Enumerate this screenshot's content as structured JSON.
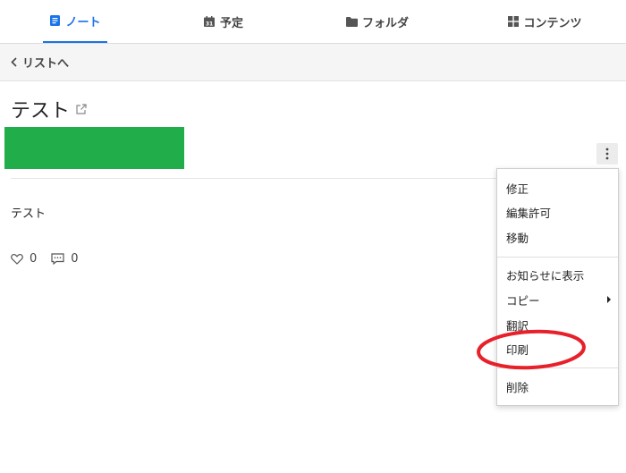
{
  "tabs": [
    {
      "label": "ノート",
      "icon": "note-icon",
      "active": true
    },
    {
      "label": "予定",
      "icon": "calendar-icon",
      "active": false
    },
    {
      "label": "フォルダ",
      "icon": "folder-icon",
      "active": false
    },
    {
      "label": "コンテンツ",
      "icon": "grid-icon",
      "active": false
    }
  ],
  "back": {
    "label": "リストへ",
    "icon": "chevron-left-icon"
  },
  "note": {
    "title": "テスト",
    "body": "テスト",
    "likes": "0",
    "comments": "0"
  },
  "menu": {
    "edit": "修正",
    "edit_permission": "編集許可",
    "move": "移動",
    "show_in_notice": "お知らせに表示",
    "copy": "コピー",
    "translate": "翻訳",
    "print": "印刷",
    "delete": "削除"
  },
  "colors": {
    "accent": "#1a73e8",
    "green_block": "#22ad4b",
    "annotation": "#e8202a"
  }
}
